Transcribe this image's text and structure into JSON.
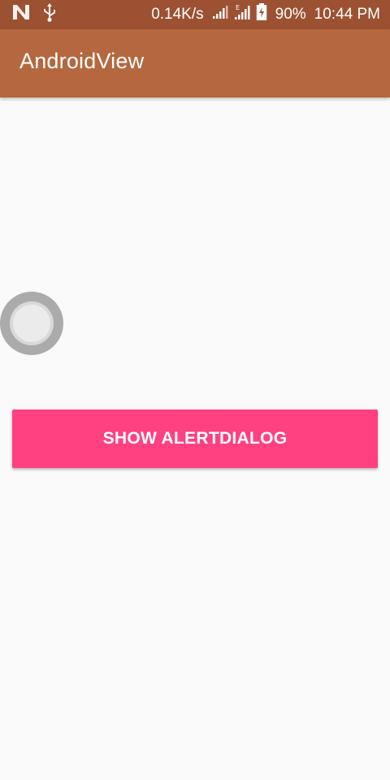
{
  "status_bar": {
    "network_speed": "0.14K/s",
    "battery_percent": "90%",
    "time": "10:44 PM",
    "icons": [
      "n-notification-icon",
      "usb-icon",
      "signal-icon",
      "signal-e-icon",
      "battery-charging-icon"
    ]
  },
  "app_bar": {
    "title": "AndroidView"
  },
  "main": {
    "button_label": "SHOW ALERTDIALOG"
  },
  "colors": {
    "status_bar": "#9c5132",
    "app_bar": "#b5683f",
    "accent": "#ff4081",
    "background": "#fafafa"
  }
}
